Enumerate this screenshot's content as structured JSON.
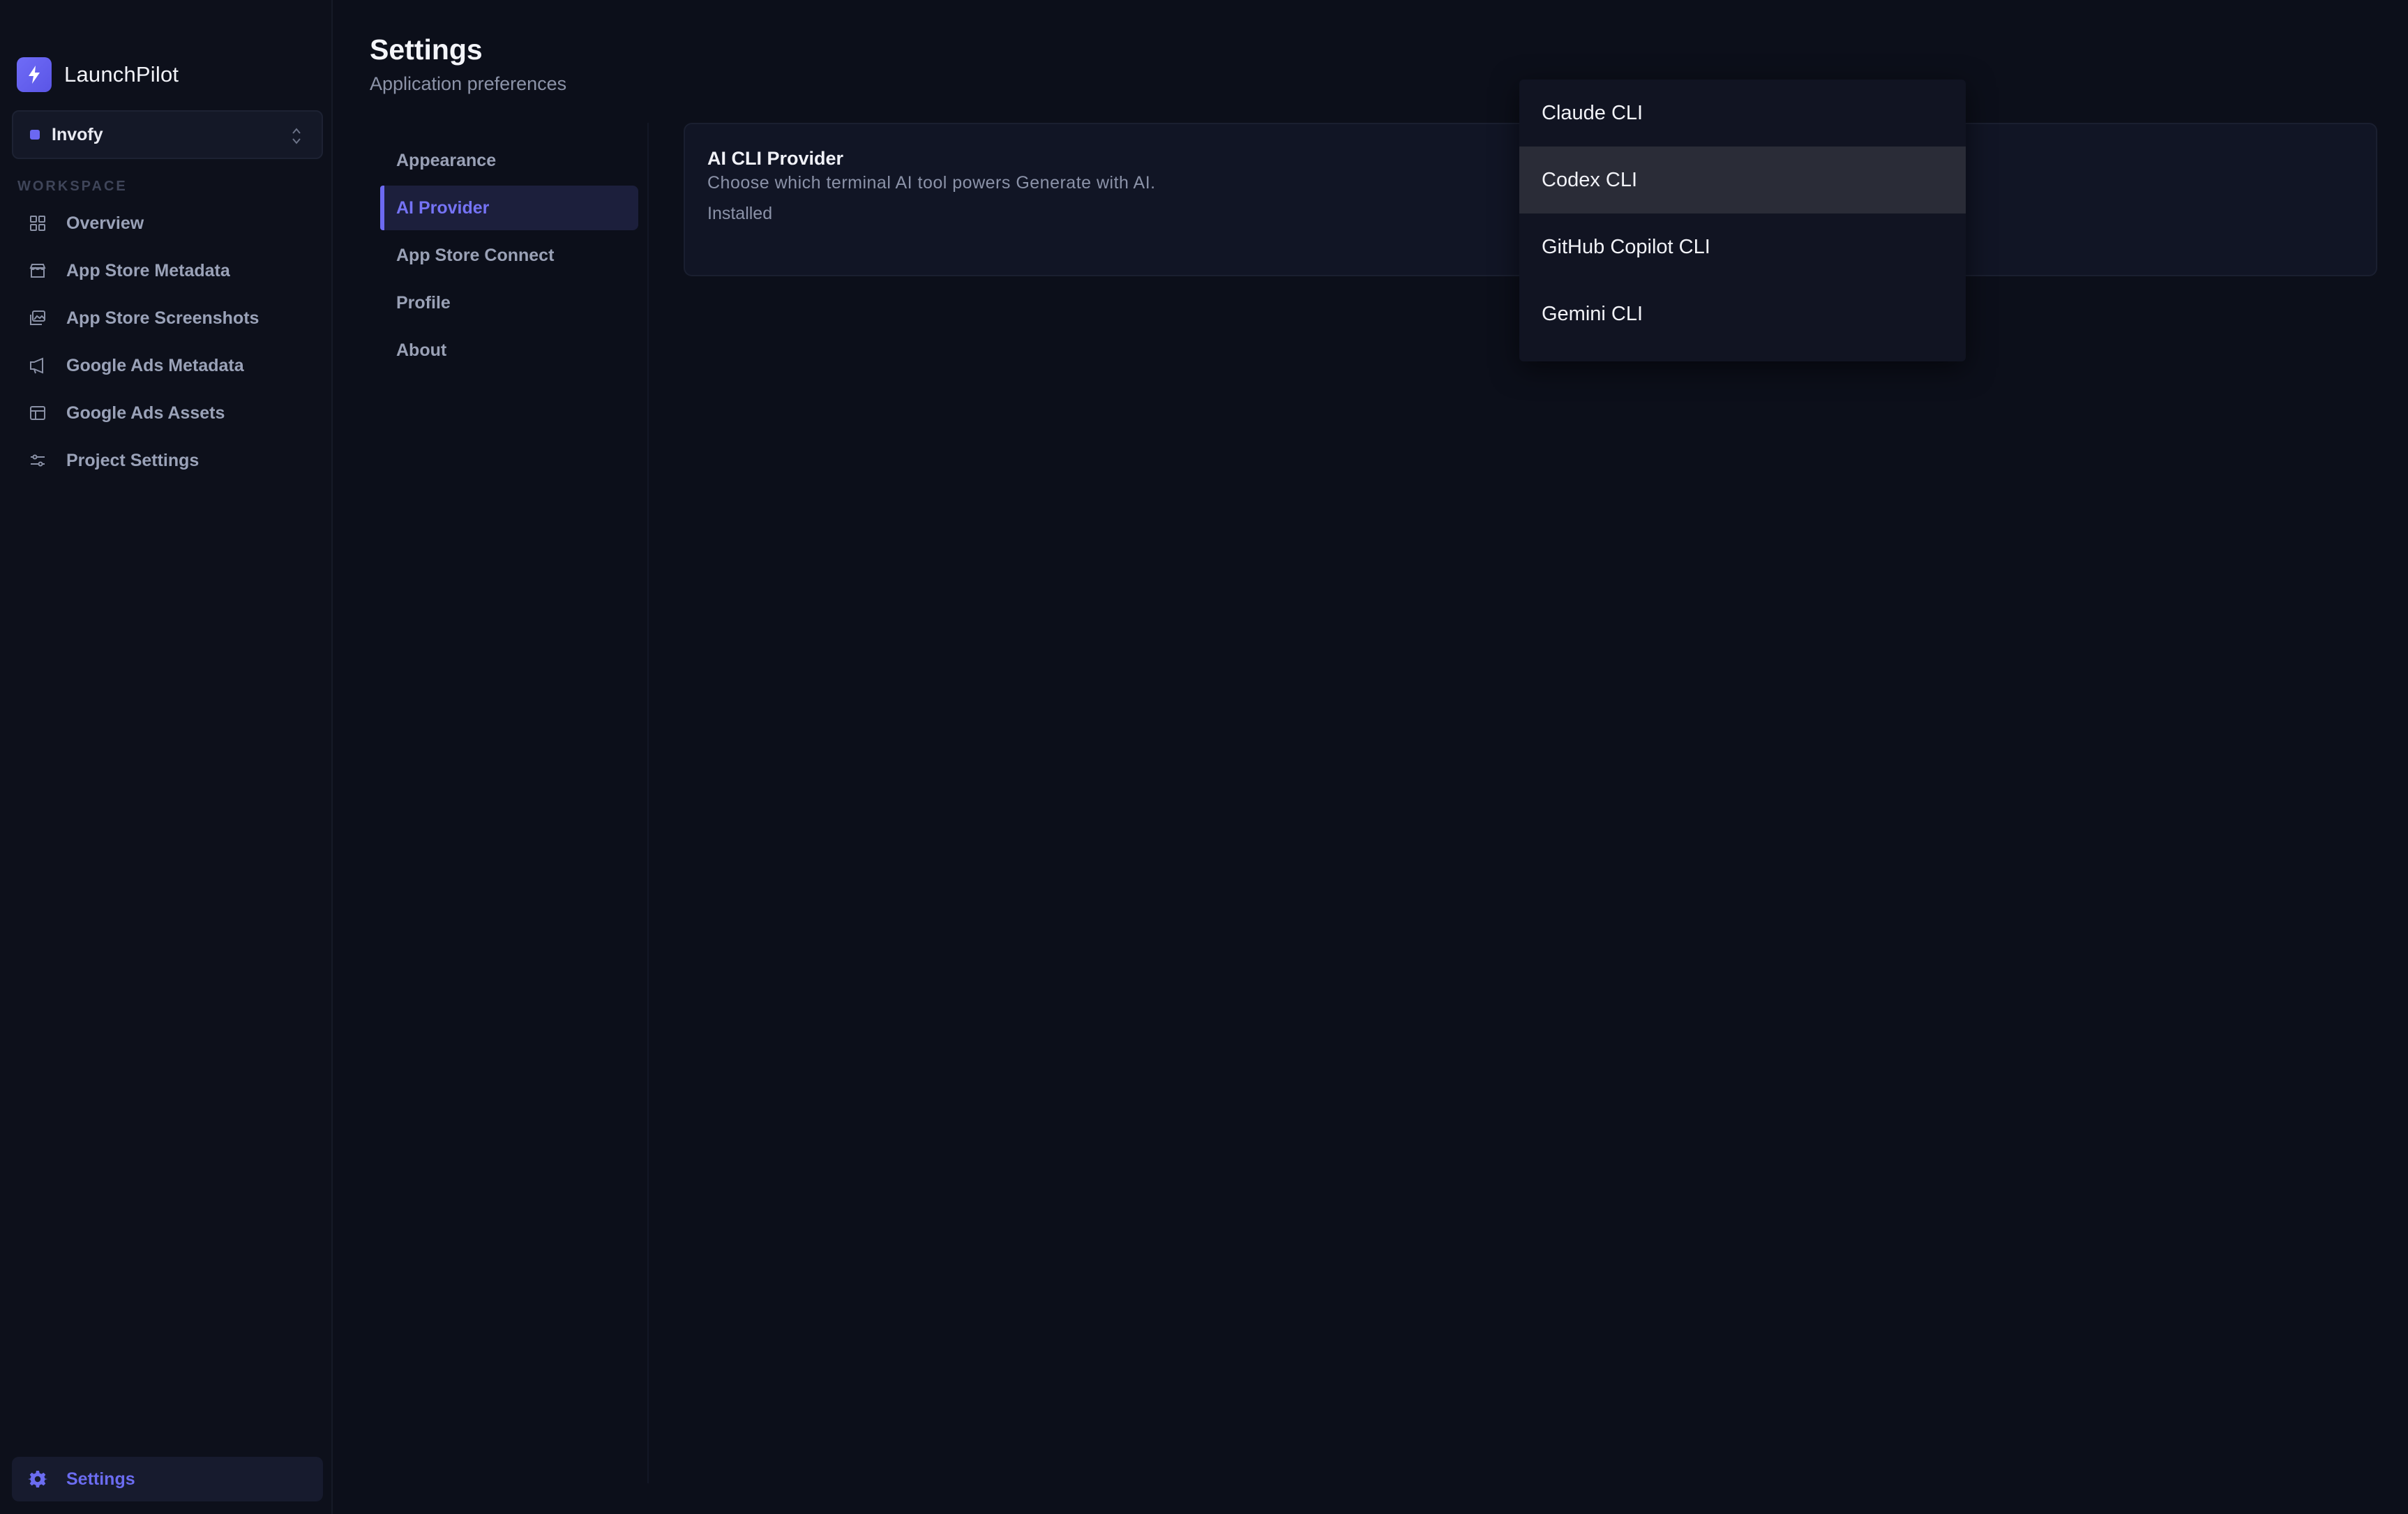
{
  "app": {
    "name": "LaunchPilot",
    "logo_icon": "bolt-icon",
    "accent": "#6b68f2"
  },
  "project": {
    "name": "Invofy",
    "dot_color": "#6b68f2"
  },
  "sidebar": {
    "section_label": "WORKSPACE",
    "items": [
      {
        "label": "Overview",
        "icon": "grid-icon"
      },
      {
        "label": "App Store Metadata",
        "icon": "store-icon"
      },
      {
        "label": "App Store Screenshots",
        "icon": "images-icon"
      },
      {
        "label": "Google Ads Metadata",
        "icon": "megaphone-icon"
      },
      {
        "label": "Google Ads Assets",
        "icon": "layout-icon"
      },
      {
        "label": "Project Settings",
        "icon": "sliders-icon"
      }
    ],
    "settings": {
      "label": "Settings",
      "icon": "gear-icon"
    }
  },
  "header": {
    "title": "Settings",
    "subtitle": "Application preferences"
  },
  "settings_menu": {
    "items": [
      {
        "label": "Appearance"
      },
      {
        "label": "AI Provider",
        "active": true
      },
      {
        "label": "App Store Connect"
      },
      {
        "label": "Profile"
      },
      {
        "label": "About"
      }
    ]
  },
  "card": {
    "title": "AI CLI Provider",
    "description": "Choose which terminal AI tool powers Generate with AI.",
    "status": "Installed"
  },
  "dropdown": {
    "options": [
      {
        "label": "Claude CLI"
      },
      {
        "label": "Codex CLI",
        "highlighted": true
      },
      {
        "label": "GitHub Copilot CLI"
      },
      {
        "label": "Gemini CLI"
      }
    ]
  }
}
